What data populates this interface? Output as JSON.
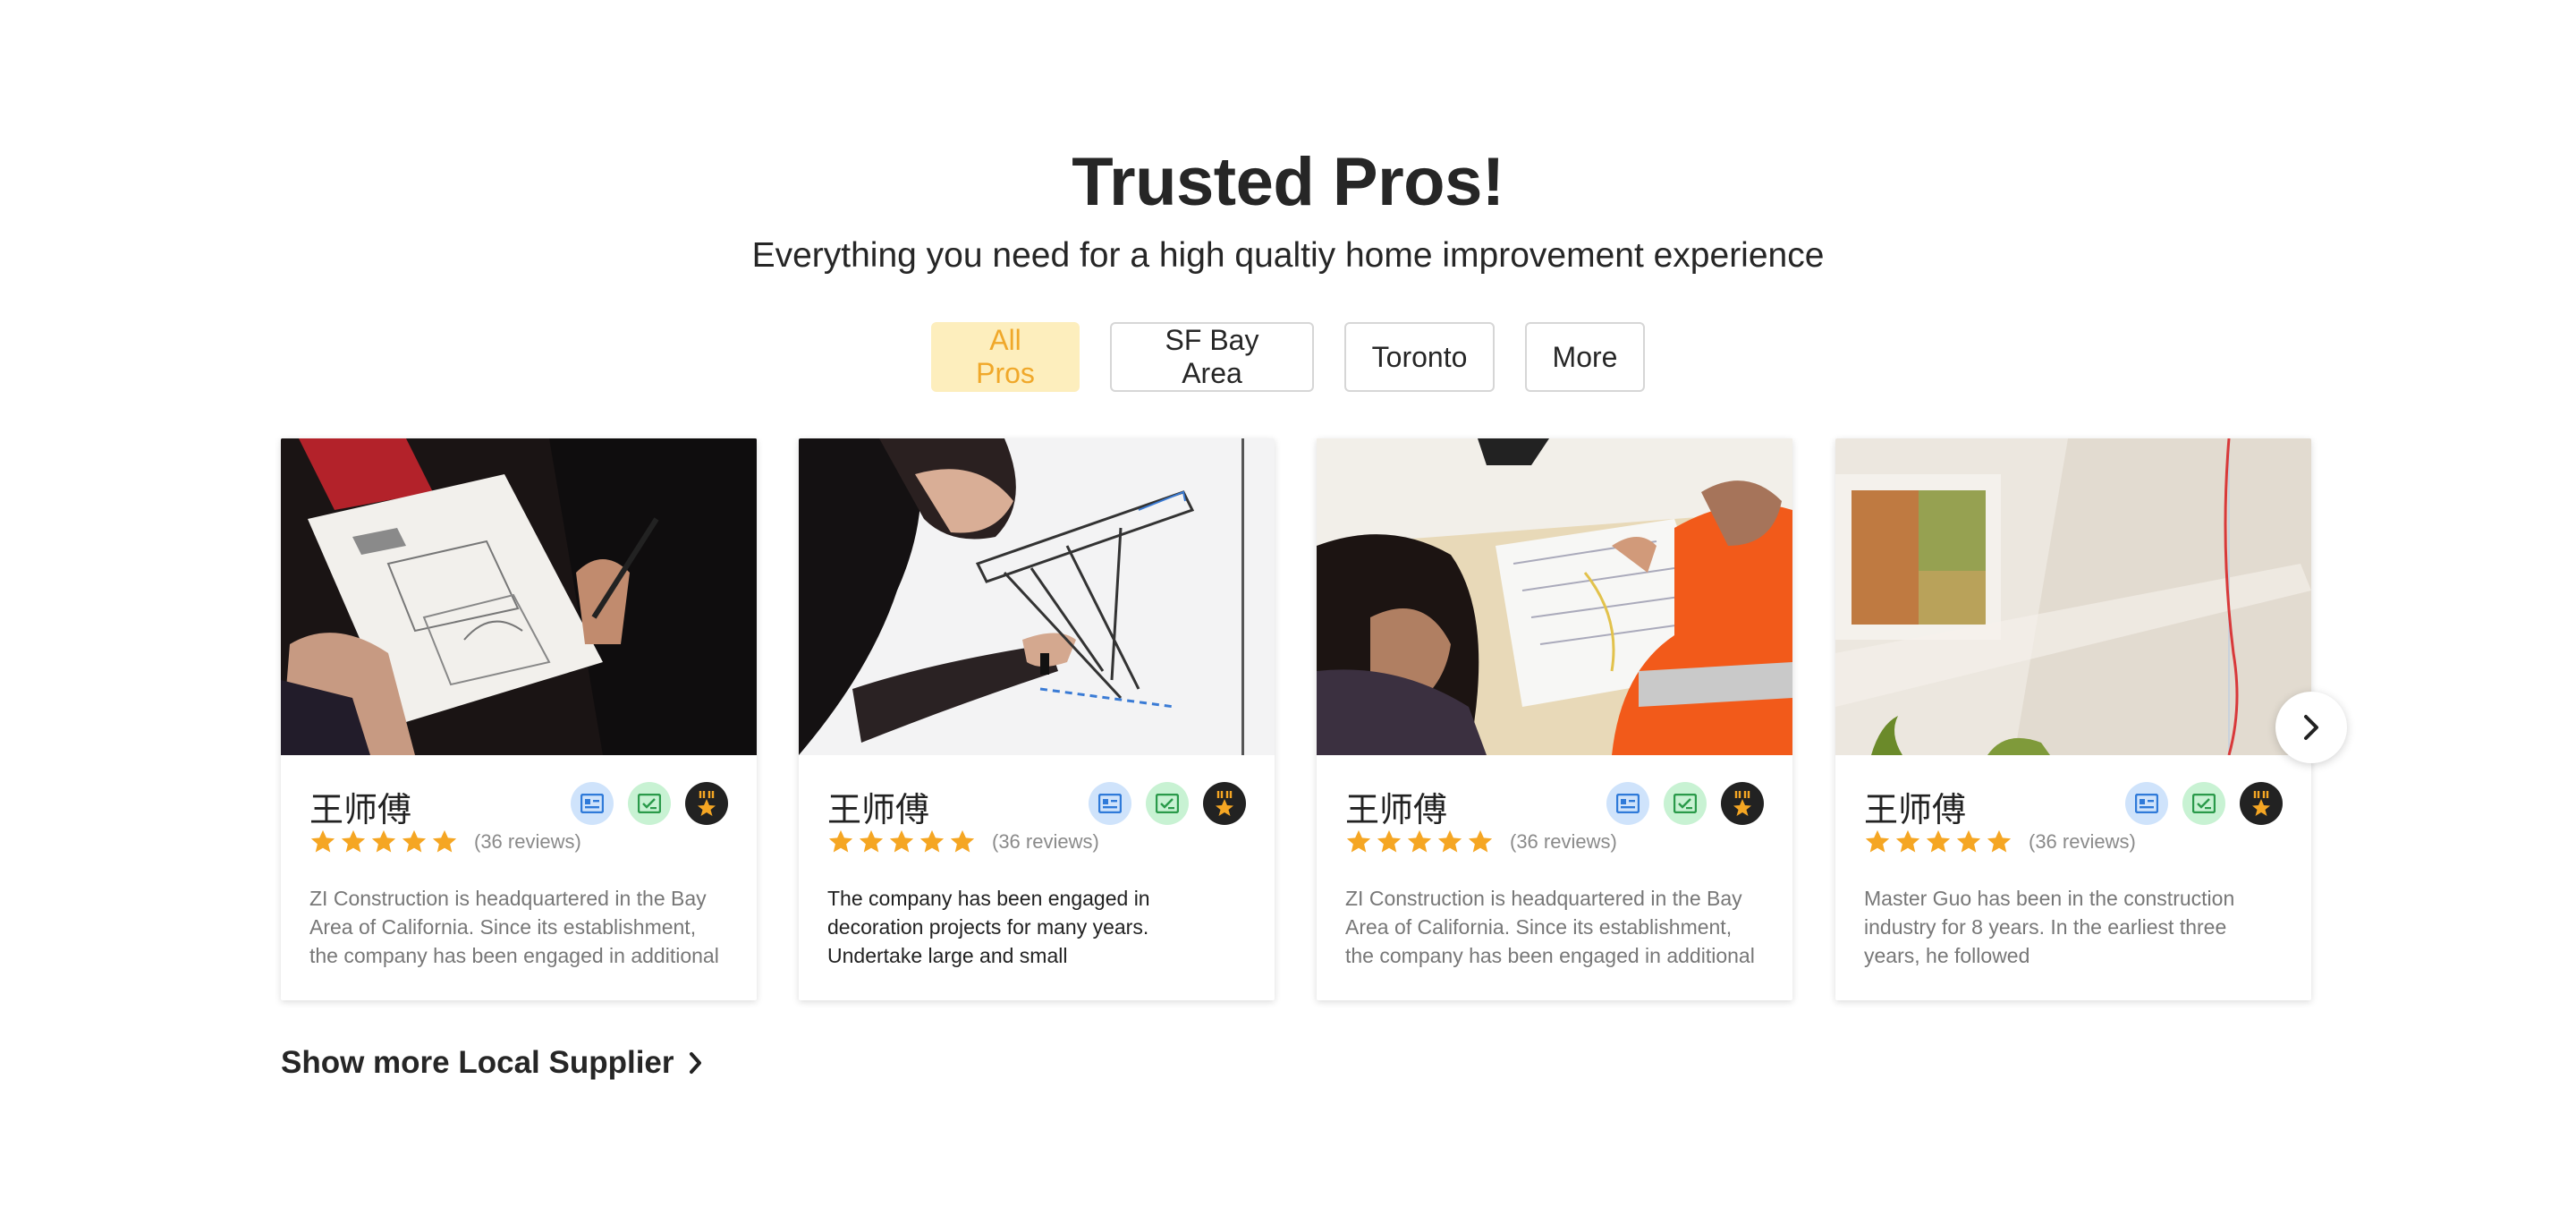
{
  "header": {
    "title": "Trusted Pros!",
    "subtitle": "Everything you need for a high qualtiy home improvement experience"
  },
  "tabs": [
    {
      "label": "All Pros",
      "active": true
    },
    {
      "label": "SF Bay Area",
      "active": false
    },
    {
      "label": "Toronto",
      "active": false
    },
    {
      "label": "More",
      "active": false
    }
  ],
  "cards": [
    {
      "name": "王师傅",
      "rating": 5,
      "reviews": "(36 reviews)",
      "description": "ZI Construction is headquartered in the Bay Area of California. Since its establishment, the company has been engaged in additional"
    },
    {
      "name": "王师傅",
      "rating": 5,
      "reviews": "(36 reviews)",
      "description": "The company has been engaged in decoration projects for many years. Undertake large and small"
    },
    {
      "name": "王师傅",
      "rating": 5,
      "reviews": "(36 reviews)",
      "description": "ZI Construction is headquartered in the Bay Area of California. Since its establishment, the company has been engaged in additional"
    },
    {
      "name": "王师傅",
      "rating": 5,
      "reviews": "(36 reviews)",
      "description": "Master Guo has been in the construction industry for 8 years. In the earliest three years, he followed"
    }
  ],
  "badge_icons": [
    "id-card-icon",
    "verified-check-icon",
    "medal-star-icon"
  ],
  "footer": {
    "show_more": "Show more Local Supplier"
  },
  "colors": {
    "accent": "#f0a82a",
    "active_tab_bg": "#fdeebd",
    "star": "#f5a623",
    "badge_blue": "#cfe3fb",
    "badge_green": "#c8f2d3"
  }
}
